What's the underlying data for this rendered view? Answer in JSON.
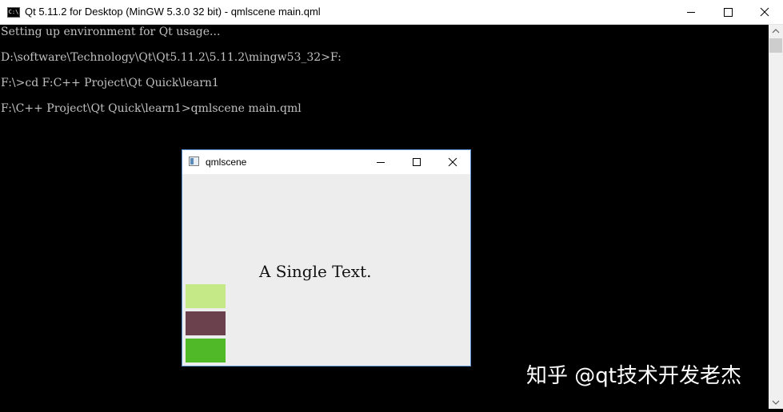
{
  "console": {
    "title": "Qt 5.11.2 for Desktop (MinGW 5.3.0 32 bit) - qmlscene  main.qml",
    "icon_text": "C:\\",
    "lines": [
      "Setting up environment for Qt usage...",
      "D:\\software\\Technology\\Qt\\Qt5.11.2\\5.11.2\\mingw53_32>F:",
      "F:\\>cd F:C++ Project\\Qt Quick\\learn1",
      "F:\\C++ Project\\Qt Quick\\learn1>qmlscene main.qml"
    ]
  },
  "qml_window": {
    "title": "qmlscene",
    "text": "A Single Text.",
    "rects": [
      {
        "color": "#c4e986"
      },
      {
        "color": "#6b414d"
      },
      {
        "color": "#4fb928"
      }
    ]
  },
  "watermark": "知乎 @qt技术开发老杰",
  "colors": {
    "console_text": "#c0c0c0",
    "console_bg": "#000000",
    "qml_bg": "#ededed",
    "window_border": "#5a8fd0"
  }
}
